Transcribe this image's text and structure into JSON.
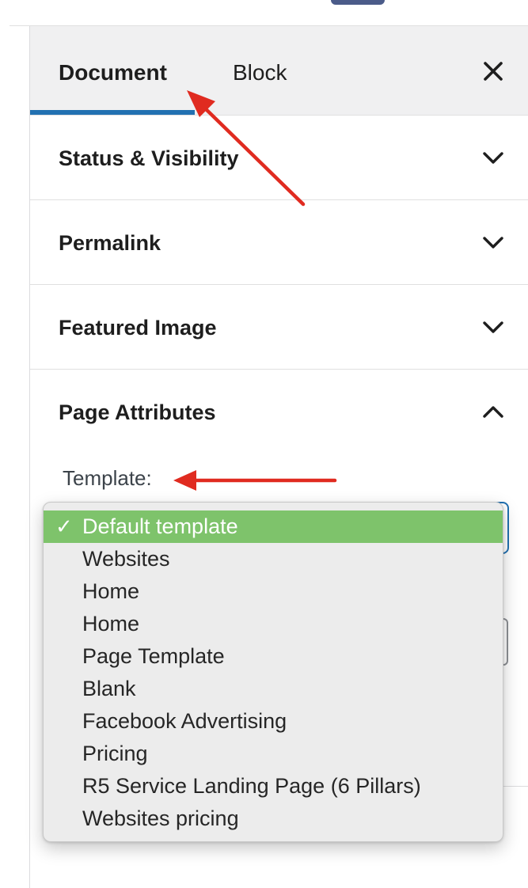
{
  "tabs": {
    "document": "Document",
    "block": "Block",
    "close_icon": "close-icon"
  },
  "panels": [
    {
      "title": "Status & Visibility",
      "state": "collapsed"
    },
    {
      "title": "Permalink",
      "state": "collapsed"
    },
    {
      "title": "Featured Image",
      "state": "collapsed"
    },
    {
      "title": "Page Attributes",
      "state": "expanded"
    }
  ],
  "page_attributes": {
    "template_label": "Template:",
    "selected_value": "Default template"
  },
  "template_options": [
    {
      "label": "Default template",
      "selected": true
    },
    {
      "label": "Websites",
      "selected": false
    },
    {
      "label": "Home",
      "selected": false
    },
    {
      "label": "Home",
      "selected": false
    },
    {
      "label": "Page Template",
      "selected": false
    },
    {
      "label": "Blank",
      "selected": false
    },
    {
      "label": "Facebook Advertising",
      "selected": false
    },
    {
      "label": "Pricing",
      "selected": false
    },
    {
      "label": "R5 Service Landing Page (6 Pillars)",
      "selected": false
    },
    {
      "label": "Websites pricing",
      "selected": false
    }
  ],
  "colors": {
    "accent": "#2271b1",
    "selected_option": "#7ec36b",
    "annotation_arrow": "#e02b20"
  },
  "check_glyph": "✓"
}
